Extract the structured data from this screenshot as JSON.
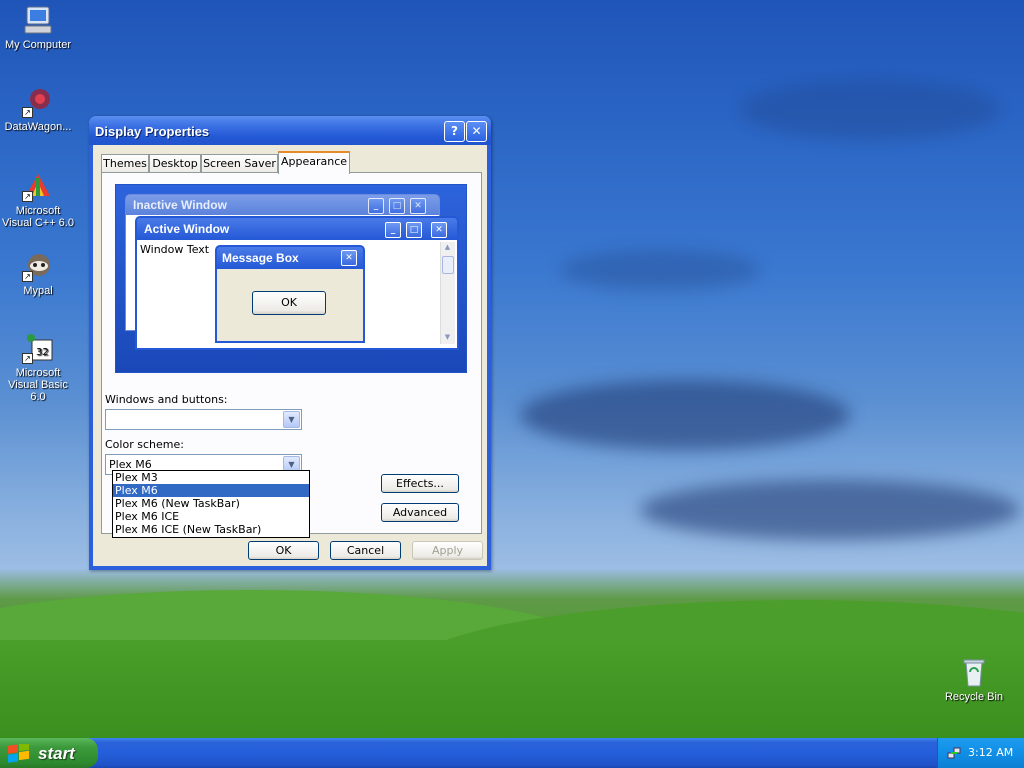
{
  "desktop": {
    "icons": [
      {
        "label": "My Computer",
        "icon": "computer-icon"
      },
      {
        "label": "DataWagon...",
        "icon": "datawagon-icon"
      },
      {
        "label": "Microsoft Visual C++ 6.0",
        "icon": "visual-cpp-icon"
      },
      {
        "label": "Mypal",
        "icon": "mypal-icon"
      },
      {
        "label": "Microsoft Visual Basic 6.0",
        "icon": "visual-basic-icon"
      },
      {
        "label": "Recycle Bin",
        "icon": "recycle-bin-icon"
      }
    ]
  },
  "dialog": {
    "title": "Display Properties",
    "help_glyph": "?",
    "close_glyph": "✕",
    "tabs": [
      {
        "label": "Themes"
      },
      {
        "label": "Desktop"
      },
      {
        "label": "Screen Saver"
      },
      {
        "label": "Appearance",
        "active": true
      }
    ],
    "preview": {
      "inactive_title": "Inactive Window",
      "active_title": "Active Window",
      "window_text": "Window Text",
      "message_box_title": "Message Box",
      "ok_label": "OK"
    },
    "windows_buttons_label": "Windows and buttons:",
    "windows_buttons_value": "",
    "color_scheme_label": "Color scheme:",
    "color_scheme_value": "Plex M6",
    "color_scheme_options": [
      "Plex M3",
      "Plex M6",
      "Plex M6 (New TaskBar)",
      "Plex M6 ICE",
      "Plex M6 ICE (New TaskBar)"
    ],
    "color_scheme_selected_index": 1,
    "effects_label": "Effects...",
    "advanced_label": "Advanced",
    "ok_label": "OK",
    "cancel_label": "Cancel",
    "apply_label": "Apply"
  },
  "taskbar": {
    "start_label": "start",
    "clock": "3:12 AM"
  },
  "colors": {
    "xp_blue": "#2b5fdc",
    "start_green": "#3c9a3c",
    "dialog_face": "#ece9d8",
    "selection": "#316ac5"
  }
}
